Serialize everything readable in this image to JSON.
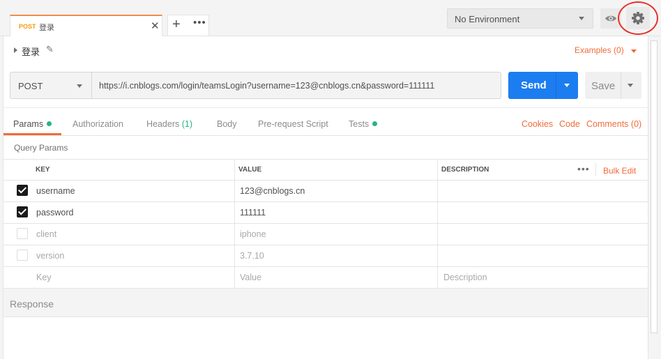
{
  "tab": {
    "method": "POST",
    "name": "登录",
    "close_icon": "close-icon"
  },
  "tab_actions": {
    "add": "+",
    "more": "•••"
  },
  "environment": {
    "selected": "No Environment"
  },
  "request": {
    "name": "登录",
    "examples_label": "Examples (0)"
  },
  "url_bar": {
    "method": "POST",
    "url": "https://i.cnblogs.com/login/teamsLogin?username=123@cnblogs.cn&password=111111",
    "send_label": "Send",
    "save_label": "Save"
  },
  "request_tabs": {
    "params": "Params",
    "authorization": "Authorization",
    "headers": "Headers",
    "headers_count": "(1)",
    "body": "Body",
    "prerequest": "Pre-request Script",
    "tests": "Tests",
    "cookies": "Cookies",
    "code": "Code",
    "comments": "Comments (0)"
  },
  "query": {
    "title": "Query Params",
    "headers": {
      "key": "KEY",
      "value": "VALUE",
      "description": "DESCRIPTION",
      "more": "•••",
      "bulk_edit": "Bulk Edit"
    },
    "rows": [
      {
        "checked": true,
        "key": "username",
        "value": "123@cnblogs.cn",
        "description": ""
      },
      {
        "checked": true,
        "key": "password",
        "value": "111111",
        "description": ""
      },
      {
        "checked": false,
        "key": "client",
        "value": "iphone",
        "description": ""
      },
      {
        "checked": false,
        "key": "version",
        "value": "3.7.10",
        "description": ""
      }
    ],
    "placeholder": {
      "key": "Key",
      "value": "Value",
      "description": "Description"
    }
  },
  "response": {
    "label": "Response"
  },
  "colors": {
    "accent_orange": "#f26b3a",
    "send_blue": "#1c7df0",
    "status_green": "#26b47f",
    "annotation_red": "#e8302a"
  }
}
